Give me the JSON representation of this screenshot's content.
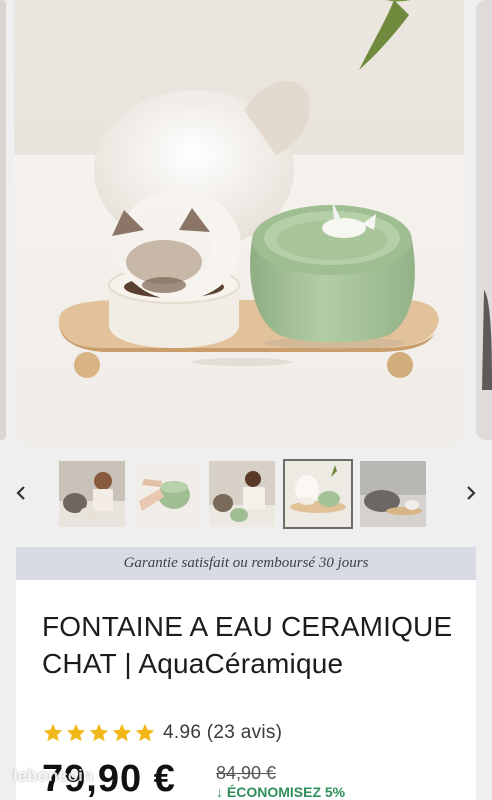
{
  "gallery": {
    "prev_label": "previous",
    "next_label": "next",
    "thumbnails": [
      {
        "name": "thumb-cat-woman-fountain"
      },
      {
        "name": "thumb-hands-fountain"
      },
      {
        "name": "thumb-woman-cat-green-fountain"
      },
      {
        "name": "thumb-cat-eating-set"
      },
      {
        "name": "thumb-cat-bowl-set"
      }
    ]
  },
  "banner": {
    "guarantee": "Garantie satisfait ou remboursé 30 jours"
  },
  "product": {
    "title": "FONTAINE A EAU CERAMIQUE CHAT | AquaCéramique",
    "rating_text": "4.96 (23 avis)",
    "stars": 5,
    "price": "79,90 €",
    "old_price": "84,90 €",
    "savings": "↓ ÉCONOMISEZ 5%"
  },
  "watermark": "leboncoin",
  "colors": {
    "star": "#f2b819",
    "banner_bg": "#d8dae4",
    "savings": "#2f8f5b",
    "bowl_green": "#a9c79a"
  }
}
